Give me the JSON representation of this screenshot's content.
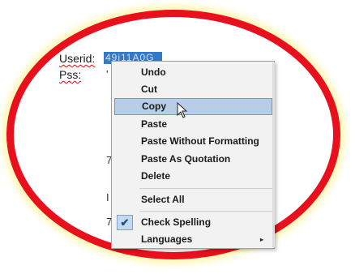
{
  "document": {
    "userid_label": "Userid:",
    "userid_value": "49j11A0G",
    "pss_label": "Pss:",
    "stray_chars": [
      "'",
      "7",
      "I",
      "7"
    ]
  },
  "context_menu": {
    "items": [
      {
        "label": "Undo",
        "state": "normal"
      },
      {
        "label": "Cut",
        "state": "normal"
      },
      {
        "label": "Copy",
        "state": "hover"
      },
      {
        "label": "Paste",
        "state": "normal"
      },
      {
        "label": "Paste Without Formatting",
        "state": "normal"
      },
      {
        "label": "Paste As Quotation",
        "state": "normal"
      },
      {
        "label": "Delete",
        "state": "normal"
      },
      {
        "label": "Select All",
        "state": "normal"
      },
      {
        "label": "Check Spelling",
        "state": "checked"
      },
      {
        "label": "Languages",
        "state": "submenu"
      }
    ],
    "submenu_arrow": "▸",
    "check_mark": "✔"
  },
  "annotation": {
    "ring_color": "#e8101c",
    "glow_color": "#ffe93a"
  },
  "colors": {
    "selection": "#3478c8",
    "hover": "#b8cde6"
  }
}
